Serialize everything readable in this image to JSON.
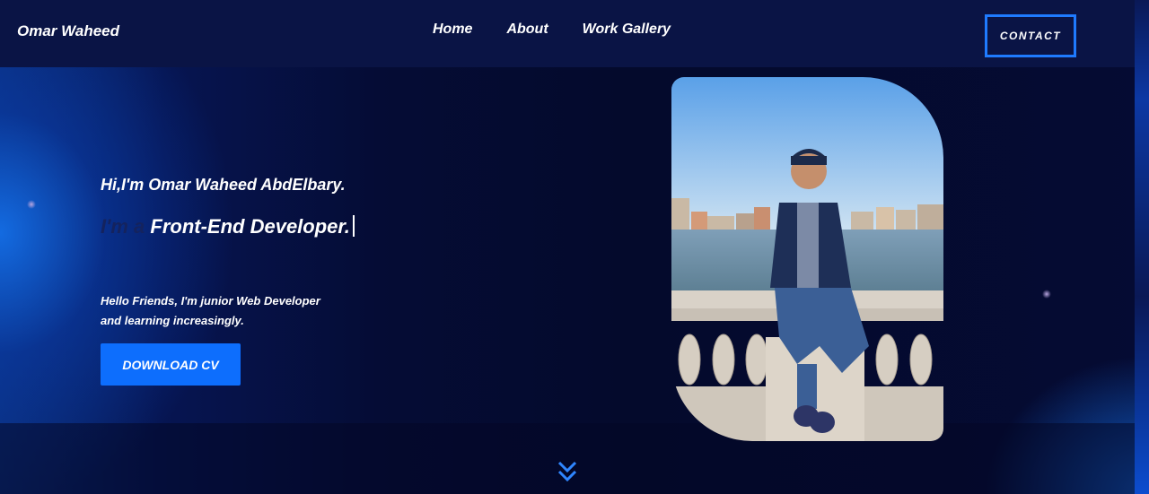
{
  "header": {
    "logo": "Omar Waheed",
    "nav": [
      {
        "label": "Home"
      },
      {
        "label": "About"
      },
      {
        "label": "Work Gallery"
      }
    ],
    "contact_label": "CONTACT"
  },
  "hero": {
    "greeting": "Hi,I'm Omar Waheed AbdElbary.",
    "role_prefix": "I'm a",
    "role": "Front-End Developer.",
    "intro_line1": "Hello Friends, I'm junior Web Developer",
    "intro_line2": "and learning increasingly.",
    "download_label": "DOWNLOAD CV"
  },
  "icons": {
    "scroll": "double-chevron-down-icon"
  },
  "colors": {
    "accent": "#0d6efd",
    "header_bg": "#0a1445",
    "page_bg": "#050a2a",
    "contact_border": "#1f7bff"
  }
}
